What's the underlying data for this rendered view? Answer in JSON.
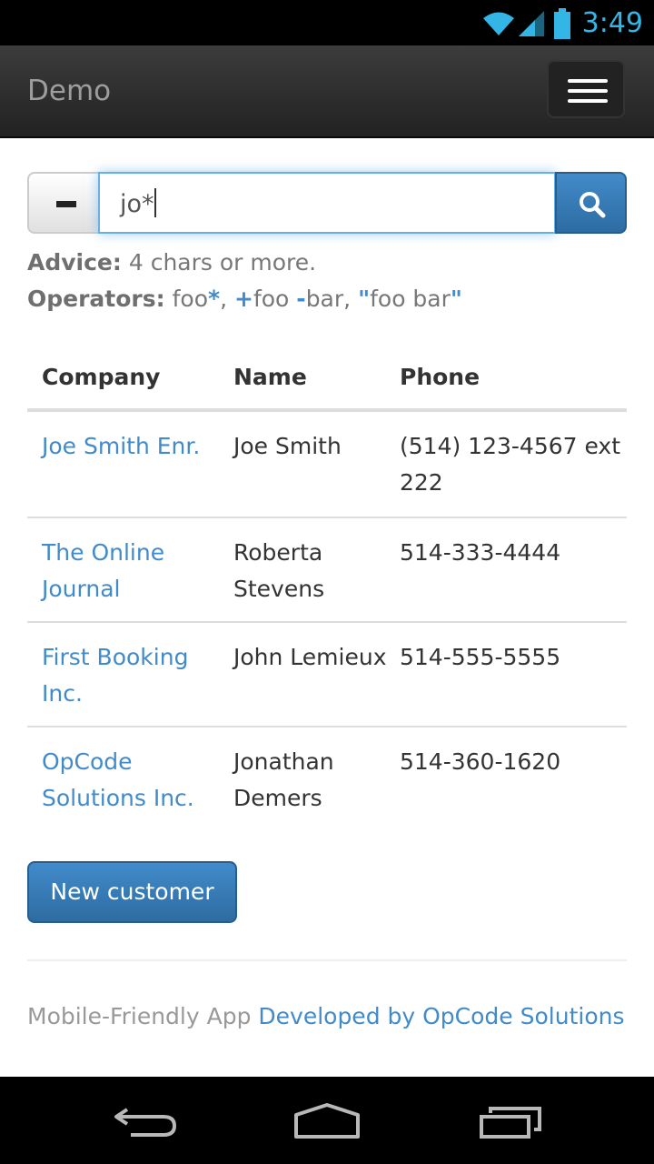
{
  "status_bar": {
    "time": "3:49",
    "accent": "#33b5e5"
  },
  "navbar": {
    "brand": "Demo"
  },
  "search": {
    "value": "jo*",
    "minus_icon": "minus-icon",
    "search_icon": "magnifier-icon"
  },
  "help": {
    "advice_label": "Advice:",
    "advice_text": "4 chars or more.",
    "operators_label": "Operators:",
    "op1_text": "foo",
    "op1_sym": "*",
    "sep1": ",",
    "op2_sym": "+",
    "op2_text": "foo",
    "op3_sym": "-",
    "op3_text": "bar,",
    "op4_open": "\"",
    "op4_text": "foo bar",
    "op4_close": "\""
  },
  "table": {
    "headers": [
      "Company",
      "Name",
      "Phone"
    ],
    "rows": [
      {
        "company": "Joe Smith Enr.",
        "name": "Joe Smith",
        "phone": "(514) 123-4567 ext 222"
      },
      {
        "company": "The Online Journal",
        "name": "Roberta Stevens",
        "phone": "514-333-4444"
      },
      {
        "company": "First Booking Inc.",
        "name": "John Lemieux",
        "phone": "514-555-5555"
      },
      {
        "company": "OpCode Solutions Inc.",
        "name": "Jonathan Demers",
        "phone": "514-360-1620"
      }
    ]
  },
  "new_customer_label": "New customer",
  "footer": {
    "text": "Mobile-Friendly App",
    "link": "Developed by OpCode Solutions"
  },
  "colors": {
    "link": "#428bca",
    "primary": "#428bca",
    "navbar": "#222222"
  }
}
